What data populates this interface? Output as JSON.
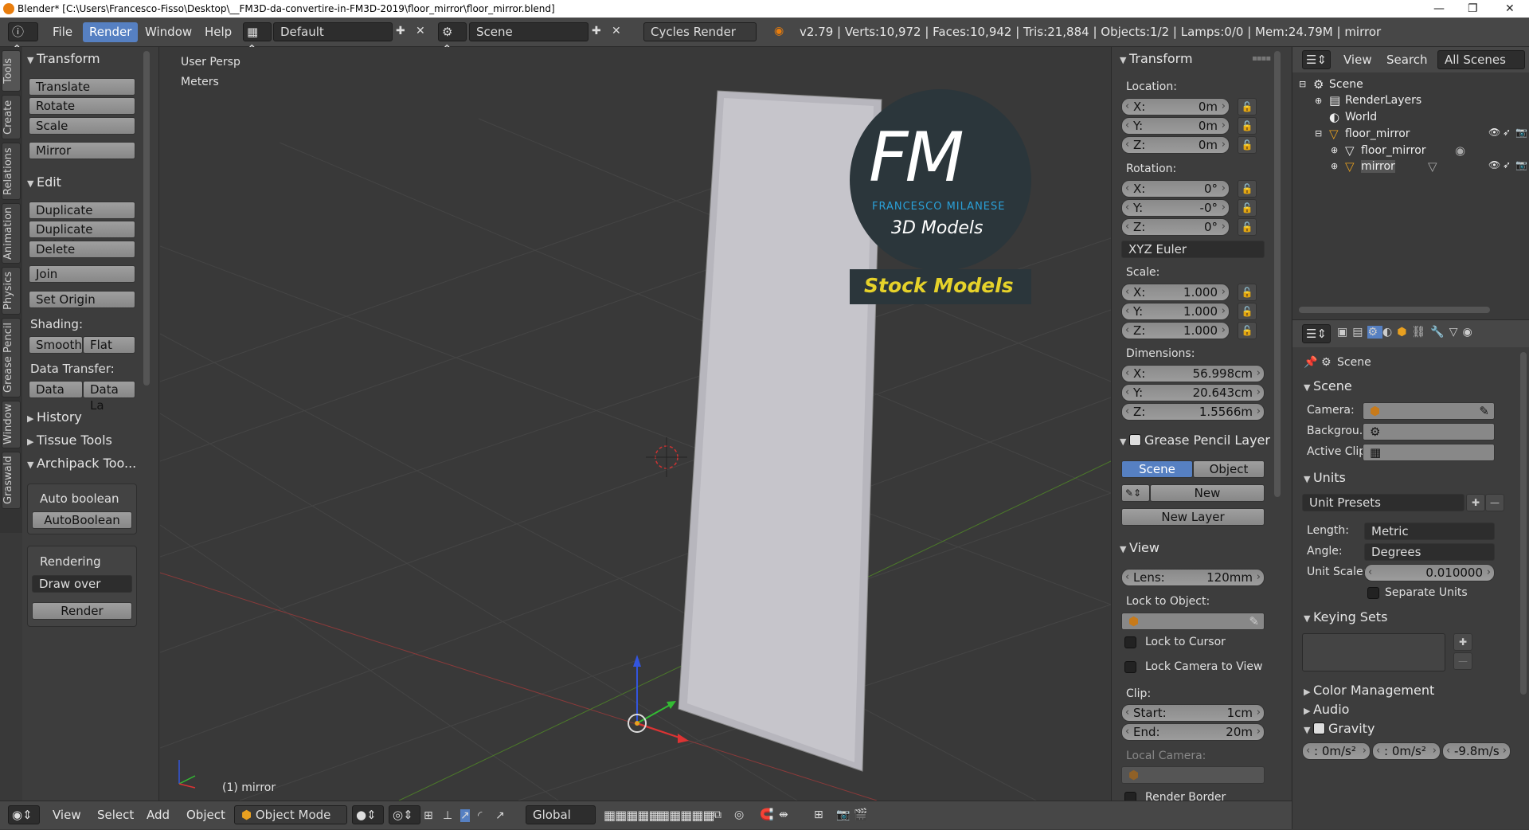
{
  "titlebar": {
    "title": "Blender* [C:\\Users\\Francesco-Fisso\\Desktop\\__FM3D-da-convertire-in-FM3D-2019\\floor_mirror\\floor_mirror.blend]",
    "minimize": "—",
    "maximize": "❐",
    "close": "✕"
  },
  "menubar": {
    "file": "File",
    "render": "Render",
    "window": "Window",
    "help": "Help",
    "layout": "Default",
    "scene": "Scene",
    "engine": "Cycles Render",
    "stats": "v2.79 | Verts:10,972 | Faces:10,942 | Tris:21,884 | Objects:1/2 | Lamps:0/0 | Mem:24.79M | mirror"
  },
  "vtabs": [
    "Tools",
    "Create",
    "Relations",
    "Animation",
    "Physics",
    "Grease Pencil",
    "Window",
    "Graswald"
  ],
  "tools": {
    "transform": "Transform",
    "translate": "Translate",
    "rotate": "Rotate",
    "scale": "Scale",
    "mirror": "Mirror",
    "edit": "Edit",
    "duplicate": "Duplicate",
    "duplicate_linked": "Duplicate Linked",
    "delete": "Delete",
    "join": "Join",
    "set_origin": "Set Origin",
    "shading": "Shading:",
    "smooth": "Smooth",
    "flat": "Flat",
    "data_transfer": "Data Transfer:",
    "data": "Data",
    "data_la": "Data La",
    "history": "History",
    "tissue": "Tissue Tools",
    "archipack": "Archipack Too...",
    "auto_boolean_lbl": "Auto boolean",
    "auto_boolean_btn": "AutoBoolean",
    "rendering": "Rendering",
    "draw_over": "Draw over",
    "render": "Render"
  },
  "viewport": {
    "persp": "User Persp",
    "units": "Meters",
    "object_label": "(1) mirror",
    "logo_fm": "FM",
    "logo_name": "FRANCESCO MILANESE",
    "logo_sub": "3D Models",
    "logo_stock": "Stock Models"
  },
  "transform_panel": {
    "title": "Transform",
    "location": "Location:",
    "loc": [
      [
        "X:",
        "0m"
      ],
      [
        "Y:",
        "0m"
      ],
      [
        "Z:",
        "0m"
      ]
    ],
    "rotation": "Rotation:",
    "rot": [
      [
        "X:",
        "0°"
      ],
      [
        "Y:",
        "-0°"
      ],
      [
        "Z:",
        "0°"
      ]
    ],
    "euler": "XYZ Euler",
    "scale": "Scale:",
    "scl": [
      [
        "X:",
        "1.000"
      ],
      [
        "Y:",
        "1.000"
      ],
      [
        "Z:",
        "1.000"
      ]
    ],
    "dimensions": "Dimensions:",
    "dim": [
      [
        "X:",
        "56.998cm"
      ],
      [
        "Y:",
        "20.643cm"
      ],
      [
        "Z:",
        "1.5566m"
      ]
    ],
    "gp_layer": "Grease Pencil Layer",
    "gp_scene": "Scene",
    "gp_object": "Object",
    "gp_new": "New",
    "gp_new_layer": "New Layer",
    "view": "View",
    "lens_l": "Lens:",
    "lens_v": "120mm",
    "lock_obj": "Lock to Object:",
    "lock_cursor": "Lock to Cursor",
    "lock_camera": "Lock Camera to View",
    "clip": "Clip:",
    "start_l": "Start:",
    "start_v": "1cm",
    "end_l": "End:",
    "end_v": "20m",
    "local_camera": "Local Camera:",
    "render_border": "Render Border"
  },
  "outliner": {
    "view": "View",
    "search": "Search",
    "all_scenes": "All Scenes",
    "items": [
      "Scene",
      "RenderLayers",
      "World",
      "floor_mirror",
      "floor_mirror",
      "mirror"
    ]
  },
  "properties": {
    "scene_crumb": "Scene",
    "scene_sect": "Scene",
    "camera": "Camera:",
    "background": "Backgrou...",
    "active_clip": "Active Clip:",
    "units": "Units",
    "unit_presets": "Unit Presets",
    "length_l": "Length:",
    "length_v": "Metric",
    "angle_l": "Angle:",
    "angle_v": "Degrees",
    "unit_scale_l": "Unit Scale:",
    "unit_scale_v": "0.010000",
    "separate_units": "Separate Units",
    "keying_sets": "Keying Sets",
    "color_mgmt": "Color Management",
    "audio": "Audio",
    "gravity": "Gravity",
    "g": [
      ": 0m/s²",
      ": 0m/s²",
      "-9.8m/s"
    ]
  },
  "bottombar": {
    "view": "View",
    "select": "Select",
    "add": "Add",
    "object": "Object",
    "mode": "Object Mode",
    "orient": "Global"
  }
}
